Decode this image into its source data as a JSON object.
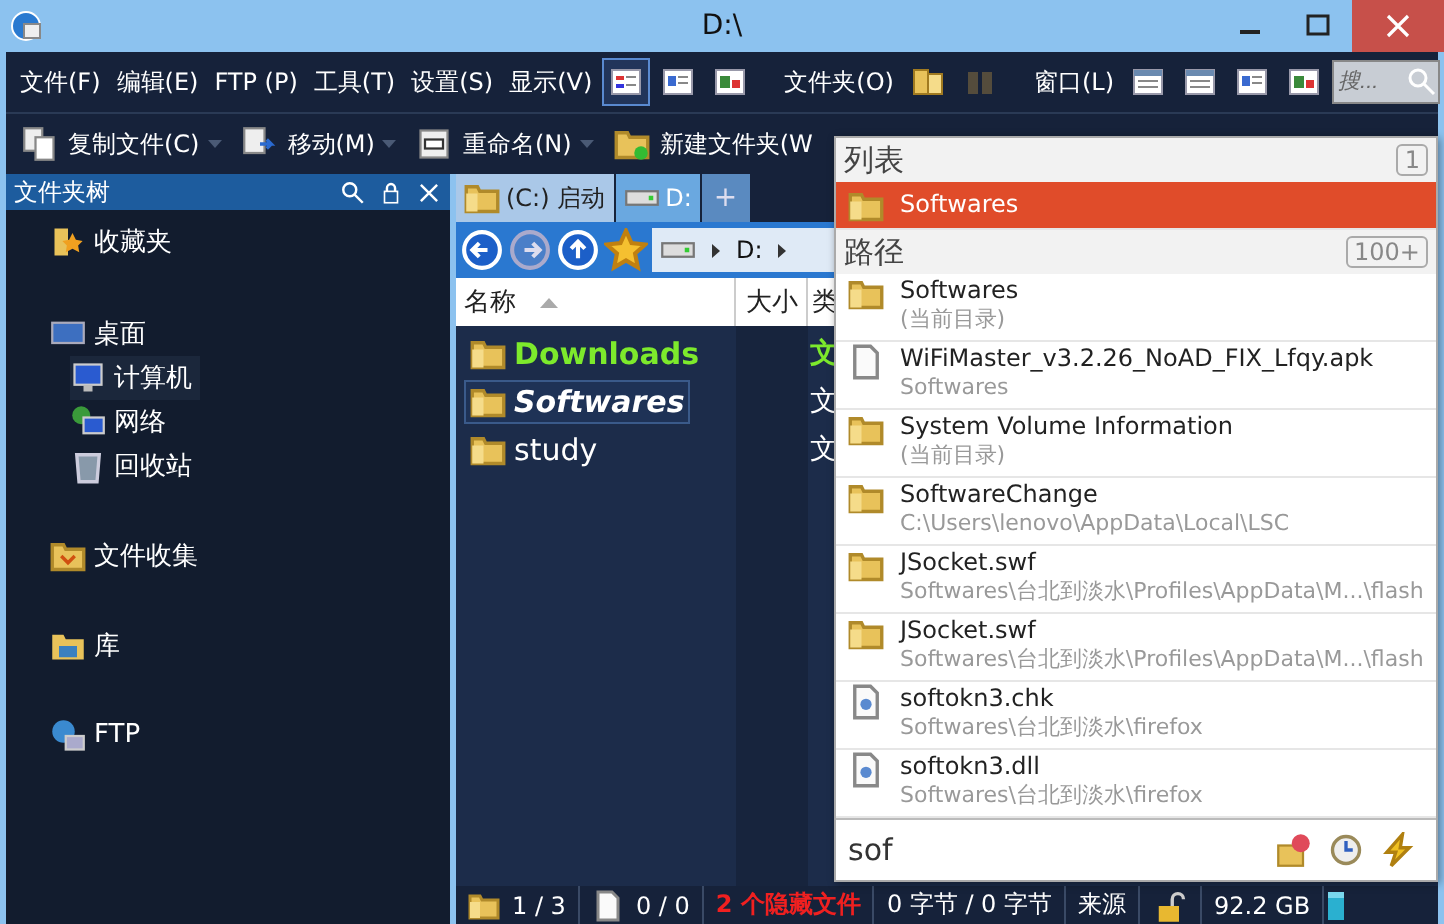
{
  "window": {
    "title": "D:\\"
  },
  "menu_bar": {
    "menus": [
      "文件(F)",
      "编辑(E)",
      "FTP (P)",
      "工具(T)",
      "设置(S)",
      "显示(V)"
    ],
    "view_buttons": [
      {
        "selected": true
      },
      {
        "selected": false
      },
      {
        "selected": false
      }
    ],
    "folder_menu": "文件夹(O)",
    "folder_buttons": [
      {
        "disabled": false
      },
      {
        "disabled": true
      }
    ],
    "window_menu": "窗口(L)",
    "search": {
      "placeholder": "搜..."
    }
  },
  "toolbar": [
    {
      "label": "复制文件(C)",
      "kind": "copy"
    },
    {
      "label": "移动(M)",
      "kind": "move"
    },
    {
      "label": "重命名(N)",
      "kind": "rename"
    },
    {
      "label": "新建文件夹(W",
      "kind": "newfolder"
    }
  ],
  "tree": {
    "title": "文件夹树",
    "items": [
      {
        "label": "收藏夹",
        "kind": "favorites",
        "selected": false
      },
      {
        "label": "桌面",
        "kind": "desktop",
        "selected": false,
        "children": [
          {
            "label": "计算机",
            "kind": "computer",
            "selected": true
          },
          {
            "label": "网络",
            "kind": "network",
            "selected": false
          },
          {
            "label": "回收站",
            "kind": "trash",
            "selected": false
          }
        ]
      },
      {
        "label": "文件收集",
        "kind": "collect",
        "selected": false
      },
      {
        "label": "库",
        "kind": "library",
        "selected": false
      },
      {
        "label": "FTP",
        "kind": "ftp",
        "selected": false
      }
    ]
  },
  "tabs": [
    {
      "label": "(C:) 启动",
      "kind": "folder",
      "selected": false
    },
    {
      "label": "D:",
      "kind": "drive",
      "selected": true
    },
    {
      "label": "+",
      "kind": "add",
      "selected": false
    }
  ],
  "address": {
    "path": [
      "D:"
    ]
  },
  "table": {
    "columns": [
      "名称",
      "大小",
      "类"
    ],
    "rows": [
      {
        "name": "Downloads",
        "column_3": "文",
        "highlighted": true,
        "selected": false
      },
      {
        "name": "Softwares",
        "column_3": "文",
        "highlighted": false,
        "selected": true
      },
      {
        "name": "study",
        "column_3": "文",
        "highlighted": false,
        "selected": false
      }
    ]
  },
  "status_bar": {
    "folders": "1 / 3",
    "files": "0 / 0",
    "hidden": "2 个隐藏文件",
    "size": "0 字节 / 0 字节",
    "source": "来源",
    "free": "92.2 GB"
  },
  "popup": {
    "sections": [
      {
        "title": "列表",
        "count": "1",
        "items": [
          {
            "name": "Softwares",
            "kind": "folder",
            "selected": true
          }
        ]
      },
      {
        "title": "路径",
        "count": "100+",
        "items": [
          {
            "name": "Softwares",
            "path": "(当前目录)",
            "kind": "folder",
            "selected": false
          },
          {
            "name": "WiFiMaster_v3.2.26_NoAD_FIX_Lfqy.apk",
            "path": "Softwares",
            "kind": "file",
            "selected": false
          },
          {
            "name": "System Volume Information",
            "path": "(当前目录)",
            "kind": "folder",
            "selected": false
          },
          {
            "name": "SoftwareChange",
            "path": "C:\\Users\\lenovo\\AppData\\Local\\LSC",
            "kind": "folder",
            "selected": false
          },
          {
            "name": "JSocket.swf",
            "path": "Softwares\\台北到淡水\\Profiles\\AppData\\M...\\flash",
            "kind": "folder",
            "selected": false
          },
          {
            "name": "JSocket.swf",
            "path": "Softwares\\台北到淡水\\Profiles\\AppData\\M...\\flash",
            "kind": "folder",
            "selected": false
          },
          {
            "name": "softokn3.chk",
            "path": "Softwares\\台北到淡水\\firefox",
            "kind": "dll",
            "selected": false
          },
          {
            "name": "softokn3.dll",
            "path": "Softwares\\台北到淡水\\firefox",
            "kind": "dll",
            "selected": false
          }
        ]
      }
    ],
    "query": "sof"
  }
}
